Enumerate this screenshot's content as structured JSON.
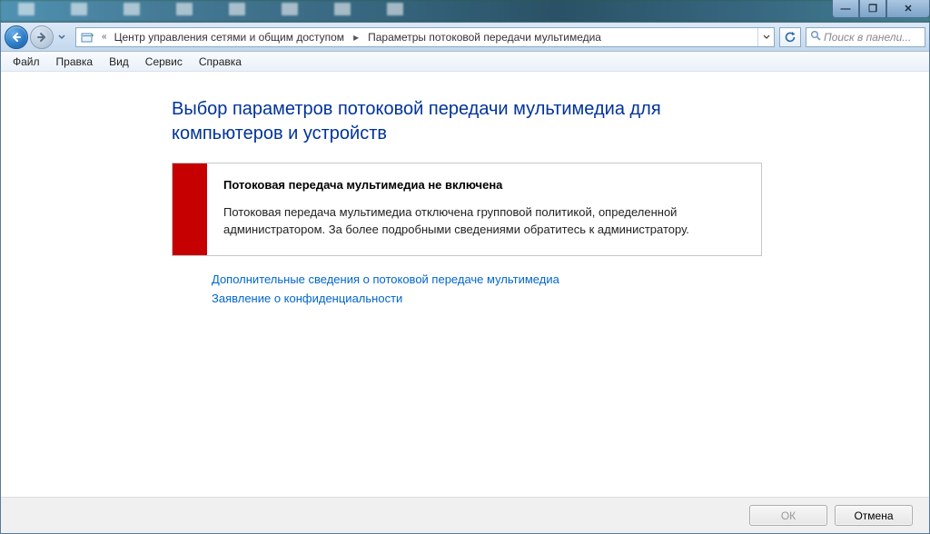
{
  "window_controls": {
    "minimize": "—",
    "maximize": "❐",
    "close": "✕"
  },
  "address": {
    "segment1": "Центр управления сетями и общим доступом",
    "segment2": "Параметры потоковой передачи мультимедиа"
  },
  "search": {
    "placeholder": "Поиск в панели..."
  },
  "menu": {
    "file": "Файл",
    "edit": "Правка",
    "view": "Вид",
    "tools": "Сервис",
    "help": "Справка"
  },
  "page": {
    "title": "Выбор параметров потоковой передачи мультимедиа для компьютеров и устройств"
  },
  "alert": {
    "heading": "Потоковая передача мультимедиа не включена",
    "text": "Потоковая передача мультимедиа отключена групповой политикой, определенной администратором. За более подробными сведениями обратитесь к администратору."
  },
  "links": {
    "more": "Дополнительные сведения о потоковой передаче мультимедиа",
    "privacy": "Заявление о конфиденциальности"
  },
  "footer": {
    "ok": "ОК",
    "cancel": "Отмена"
  }
}
